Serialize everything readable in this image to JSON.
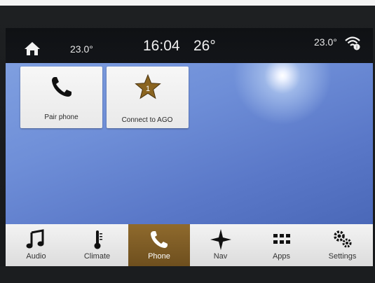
{
  "status_bar": {
    "left_temp": "23.0°",
    "time": "16:04",
    "outside_temp": "26°",
    "right_temp": "23.0°",
    "home_icon": "home-icon",
    "wifi_icon": "wifi-icon"
  },
  "tiles": [
    {
      "label": "Pair phone",
      "icon": "phone-icon"
    },
    {
      "label": "Connect to AGO",
      "icon": "star-badge-icon",
      "badge": "1"
    }
  ],
  "tabs": [
    {
      "label": "Audio",
      "icon": "music-note-icon",
      "active": false
    },
    {
      "label": "Climate",
      "icon": "thermometer-icon",
      "active": false
    },
    {
      "label": "Phone",
      "icon": "phone-icon",
      "active": true
    },
    {
      "label": "Nav",
      "icon": "compass-star-icon",
      "active": false
    },
    {
      "label": "Apps",
      "icon": "grid-icon",
      "active": false
    },
    {
      "label": "Settings",
      "icon": "gear-icon",
      "active": false
    }
  ],
  "colors": {
    "active_tab": "#7f5d26",
    "screen_blue": "#6f8fd8"
  }
}
